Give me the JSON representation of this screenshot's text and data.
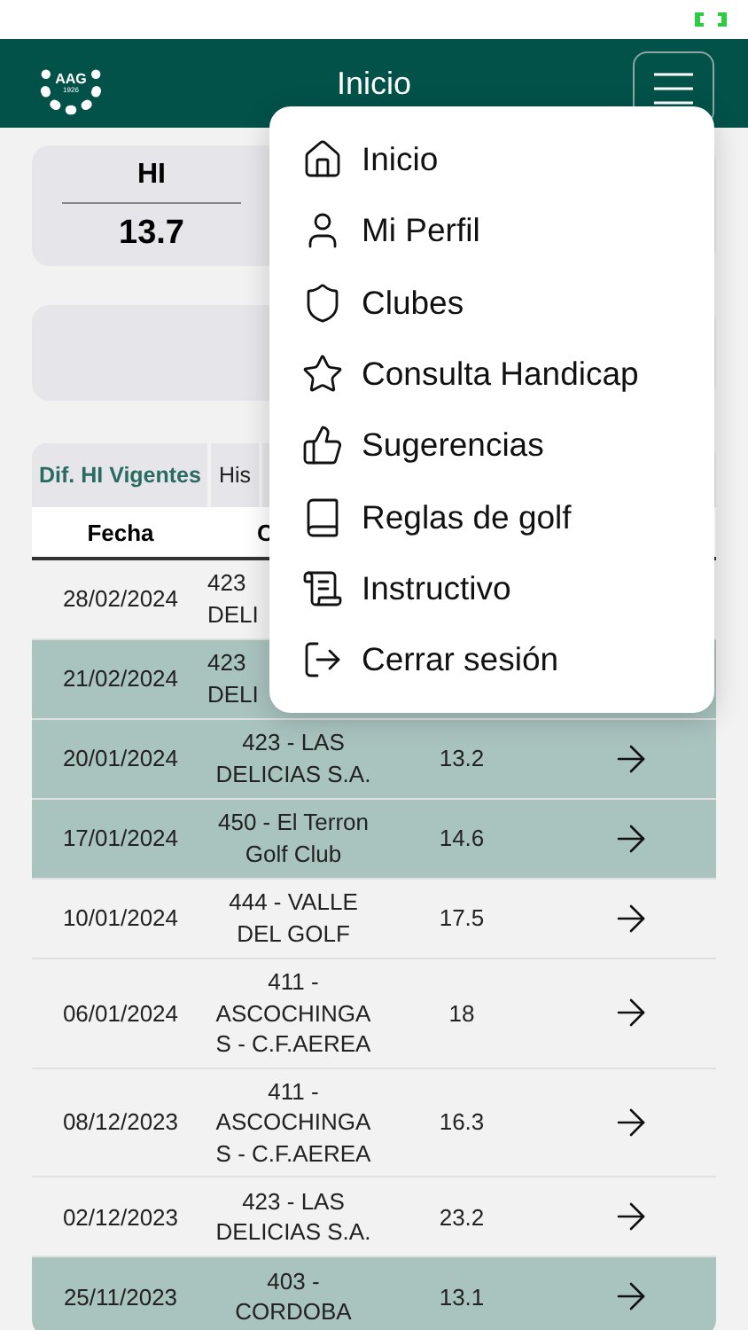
{
  "header": {
    "logo": {
      "text": "AAG",
      "year": "1926"
    },
    "title": "Inicio"
  },
  "summary": {
    "label": "HI",
    "value": "13.7"
  },
  "tabs": [
    {
      "label": "Dif. HI Vigentes",
      "selected": true
    },
    {
      "label": "His",
      "selected": false
    }
  ],
  "table": {
    "columns": [
      "Fecha",
      "C"
    ],
    "rows": [
      {
        "date": "28/02/2024",
        "course": "423\nDELI",
        "highlighted": false
      },
      {
        "date": "21/02/2024",
        "course": "423\nDELI",
        "highlighted": true
      },
      {
        "date": "20/01/2024",
        "course": "423 - LAS\nDELICIAS S.A.",
        "hi": "13.2",
        "highlighted": true
      },
      {
        "date": "17/01/2024",
        "course": "450 - El Terron\nGolf Club",
        "hi": "14.6",
        "highlighted": true
      },
      {
        "date": "10/01/2024",
        "course": "444 - VALLE\nDEL GOLF",
        "hi": "17.5",
        "highlighted": false
      },
      {
        "date": "06/01/2024",
        "course": "411 -\nASCOCHINGA\nS - C.F.AEREA",
        "hi": "18",
        "highlighted": false
      },
      {
        "date": "08/12/2023",
        "course": "411 -\nASCOCHINGA\nS - C.F.AEREA",
        "hi": "16.3",
        "highlighted": false
      },
      {
        "date": "02/12/2023",
        "course": "423 - LAS\nDELICIAS S.A.",
        "hi": "23.2",
        "highlighted": false
      },
      {
        "date": "25/11/2023",
        "course": "403 -\nCORDOBA",
        "hi": "13.1",
        "highlighted": true
      }
    ]
  },
  "menu": {
    "items": [
      {
        "label": "Inicio"
      },
      {
        "label": "Mi Perfil"
      },
      {
        "label": "Clubes"
      },
      {
        "label": "Consulta Handicap"
      },
      {
        "label": "Sugerencias"
      },
      {
        "label": "Reglas de golf"
      },
      {
        "label": "Instructivo"
      },
      {
        "label": "Cerrar sesión"
      }
    ]
  }
}
